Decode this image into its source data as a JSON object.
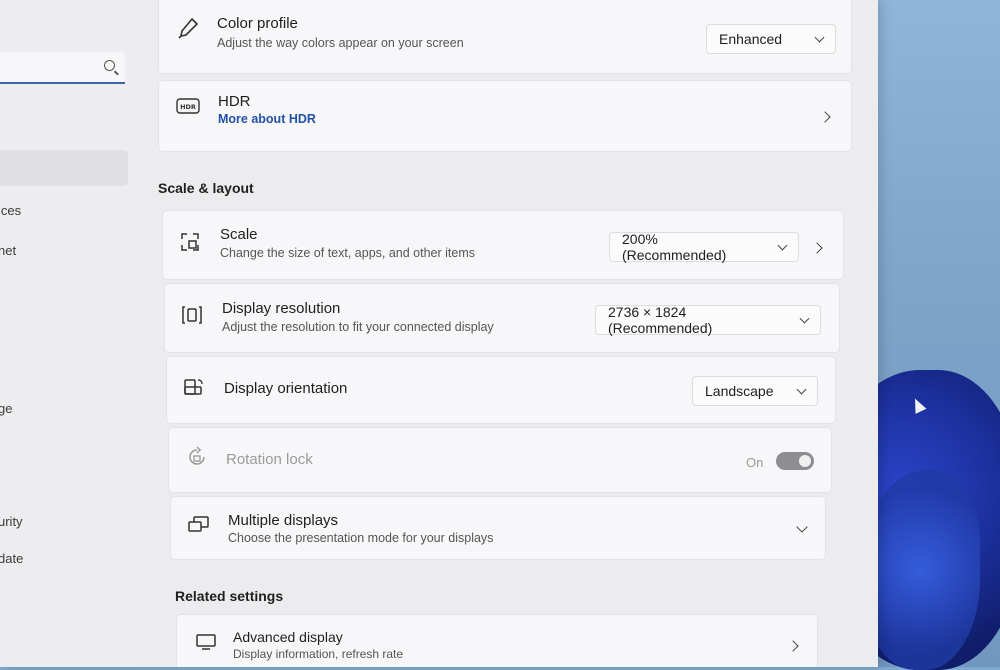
{
  "sidebar": {
    "nav_items": [
      {
        "label": "ices"
      },
      {
        "label": "net"
      },
      {
        "label": "ge"
      },
      {
        "label": "urity"
      },
      {
        "label": "date"
      }
    ]
  },
  "color_profile": {
    "title": "Color profile",
    "subtitle": "Adjust the way colors appear on your screen",
    "value": "Enhanced",
    "icon": "pen-icon"
  },
  "hdr": {
    "title": "HDR",
    "link": "More about HDR",
    "icon": "hdr-icon"
  },
  "scale_layout": {
    "heading": "Scale & layout",
    "scale": {
      "title": "Scale",
      "subtitle": "Change the size of text, apps, and other items",
      "value": "200% (Recommended)",
      "icon": "scale-icon"
    },
    "resolution": {
      "title": "Display resolution",
      "subtitle": "Adjust the resolution to fit your connected display",
      "value": "2736 × 1824 (Recommended)",
      "icon": "resolution-icon"
    },
    "orientation": {
      "title": "Display orientation",
      "value": "Landscape",
      "icon": "orientation-icon"
    },
    "rotation_lock": {
      "title": "Rotation lock",
      "state_label": "On",
      "enabled": true,
      "icon": "rotation-lock-icon"
    },
    "multiple_displays": {
      "title": "Multiple displays",
      "subtitle": "Choose the presentation mode for your displays",
      "icon": "multiple-displays-icon"
    }
  },
  "related_settings": {
    "heading": "Related settings",
    "advanced_display": {
      "title": "Advanced display",
      "subtitle": "Display information, refresh rate",
      "icon": "monitor-icon"
    }
  },
  "colors": {
    "accent": "#3a64b0",
    "link": "#2351a8",
    "toggle_on": "#8e8e92"
  }
}
